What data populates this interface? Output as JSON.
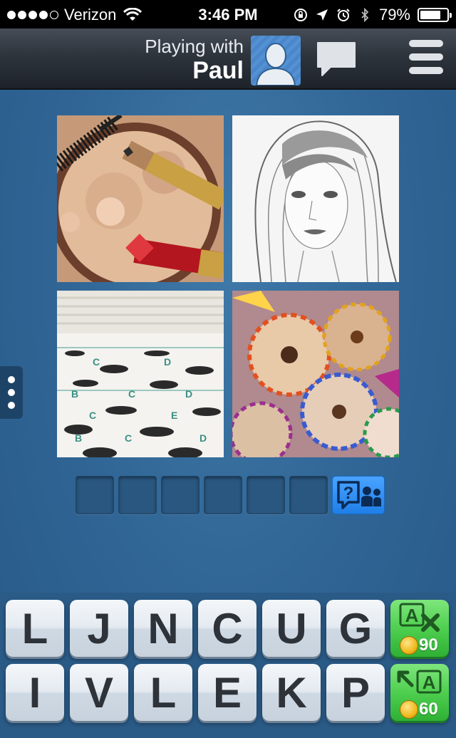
{
  "status_bar": {
    "carrier": "Verizon",
    "time": "3:46 PM",
    "battery_percent_label": "79%",
    "battery_level": 0.79,
    "signal_bars": 4,
    "signal_bars_max": 5
  },
  "header": {
    "playing_with_label": "Playing with",
    "opponent_name": "Paul"
  },
  "answer": {
    "slot_count": 6
  },
  "keyboard": {
    "row1": [
      "L",
      "J",
      "N",
      "C",
      "U",
      "G"
    ],
    "row2": [
      "I",
      "V",
      "L",
      "E",
      "K",
      "P"
    ]
  },
  "powerups": {
    "remove_letters": {
      "icon_letter": "A",
      "cost": "90"
    },
    "reveal_letter": {
      "icon_letter": "A",
      "cost": "60"
    }
  },
  "colors": {
    "background": "#2f6494",
    "header": "#2e343c",
    "key_text": "#2d3339",
    "power_green": "#4fcf4f",
    "hint_blue": "#1f7fe8"
  }
}
